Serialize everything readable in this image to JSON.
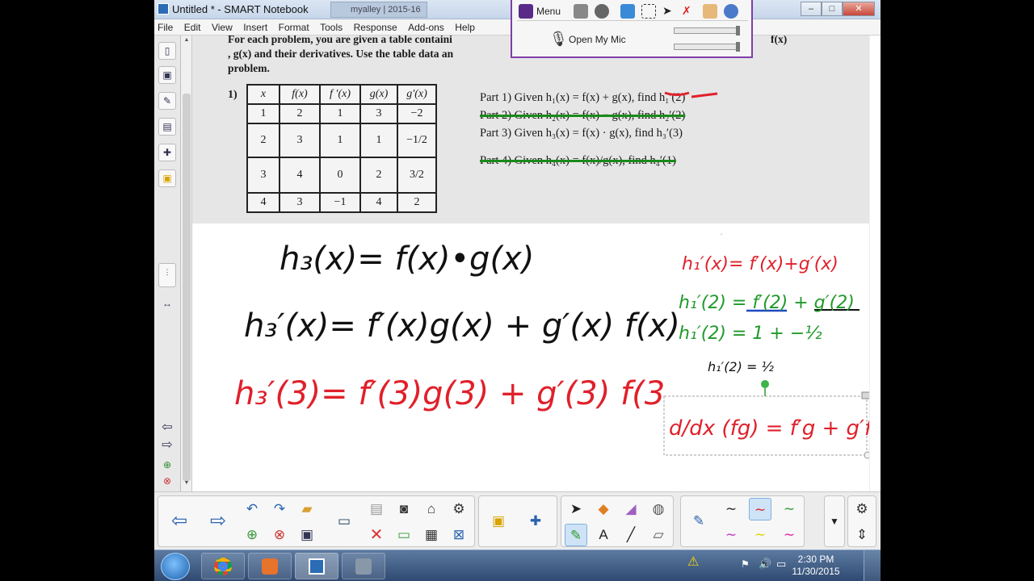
{
  "window": {
    "title": "Untitled * - SMART Notebook",
    "other_tab": "myalley | 2015-16",
    "controls": {
      "minimize": "–",
      "maximize": "□",
      "close": "✕"
    }
  },
  "menu": [
    "File",
    "Edit",
    "View",
    "Insert",
    "Format",
    "Tools",
    "Response",
    "Add-ons",
    "Help"
  ],
  "mic_toolbar": {
    "menu_label": "Menu",
    "open_mic_label": "Open My Mic"
  },
  "worksheet": {
    "instructions_line1": "For each problem, you are given a table containi",
    "instructions_line1_end": "f(x)",
    "instructions_line2": ", g(x) and their derivatives.  Use the table data an",
    "instructions_line3": "problem.",
    "problem_number": "1)",
    "table_headers": [
      "x",
      "f(x)",
      "f ′(x)",
      "g(x)",
      "g′(x)"
    ],
    "table_rows": [
      [
        "1",
        "2",
        "1",
        "3",
        "−2"
      ],
      [
        "2",
        "3",
        "1",
        "1",
        "−1/2"
      ],
      [
        "3",
        "4",
        "0",
        "2",
        "3/2"
      ],
      [
        "4",
        "3",
        "−1",
        "4",
        "2"
      ]
    ],
    "parts": [
      "Part 1) Given h₁(x) = f(x) + g(x), find h₁′(2)",
      "Part 2) Given h₂(x) = f(x) − g(x), find h₂′(2)",
      "Part 3) Given h₃(x) = f(x) · g(x), find h₃′(3)",
      "Part 4) Given h₄(x) = f(x)/g(x), find h₄′(1)"
    ]
  },
  "handwriting": {
    "line1": "h₃(x)= f(x)•g(x)",
    "line2": "h₃′(x)= f′(x)g(x) + g′(x) f(x)",
    "line3": "h₃′(3)= f′(3)g(3) + g′(3) f(3",
    "r1": "h₁′(x)= f′(x)+g′(x)",
    "r2": "h₁′(2) = f′(2) + g′(2)",
    "r3": "h₁′(2) =  1  + −½",
    "r4": "h₁′(2) = ½",
    "r5": "d/dx (fg) = f′g + g′f"
  },
  "colors": {
    "red": "#e0202a",
    "green": "#1f9a2a",
    "black": "#111111",
    "blue": "#2048c0"
  },
  "taskbar": {
    "time": "2:30 PM",
    "date": "11/30/2015"
  }
}
